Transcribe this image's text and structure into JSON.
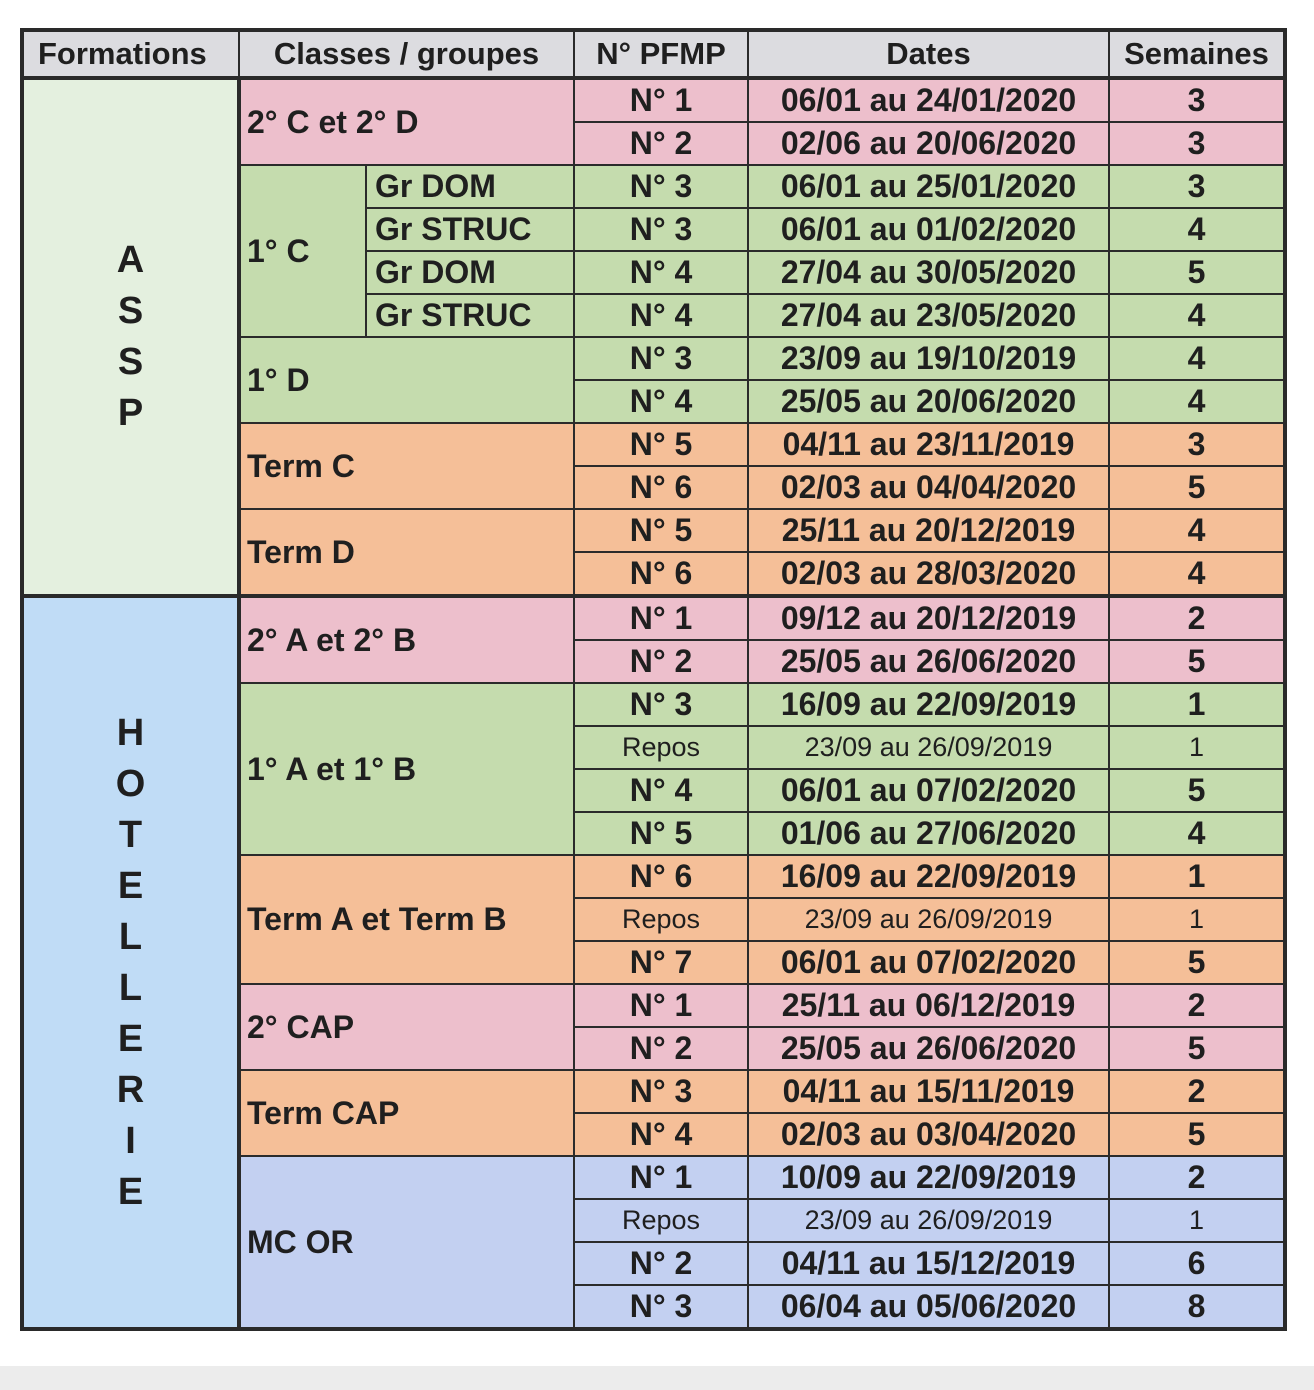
{
  "headers": {
    "formations": "Formations",
    "classes": "Classes / groupes",
    "pfmp": "N° PFMP",
    "dates": "Dates",
    "semaines": "Semaines"
  },
  "colors": {
    "pink": "#edbfcc",
    "green": "#c5dcae",
    "orange": "#f5bf98",
    "lavender": "#c3d0f1",
    "assp_bg": "#e4f0df",
    "hotellerie_bg": "#c0dcf6",
    "header_bg": "#dcdce0"
  },
  "formations": [
    {
      "name": "ASSP",
      "letters": [
        "A",
        "S",
        "S",
        "P"
      ],
      "classes": [
        {
          "label": "2° C et 2° D",
          "color": "pink",
          "rows": [
            {
              "pfmp": "N° 1",
              "dates": "06/01 au 24/01/2020",
              "semaines": "3"
            },
            {
              "pfmp": "N° 2",
              "dates": "02/06 au 20/06/2020",
              "semaines": "3"
            }
          ]
        },
        {
          "label": "1° C",
          "color": "green",
          "groups": [
            {
              "label": "Gr DOM",
              "pfmp": "N° 3",
              "dates": "06/01 au 25/01/2020",
              "semaines": "3"
            },
            {
              "label": "Gr STRUC",
              "pfmp": "N° 3",
              "dates": "06/01 au 01/02/2020",
              "semaines": "4"
            },
            {
              "label": "Gr DOM",
              "pfmp": "N° 4",
              "dates": "27/04 au 30/05/2020",
              "semaines": "5"
            },
            {
              "label": "Gr STRUC",
              "pfmp": "N° 4",
              "dates": "27/04 au 23/05/2020",
              "semaines": "4"
            }
          ]
        },
        {
          "label": "1° D",
          "color": "green",
          "rows": [
            {
              "pfmp": "N° 3",
              "dates": "23/09 au 19/10/2019",
              "semaines": "4"
            },
            {
              "pfmp": "N° 4",
              "dates": "25/05 au 20/06/2020",
              "semaines": "4"
            }
          ]
        },
        {
          "label": "Term C",
          "color": "orange",
          "rows": [
            {
              "pfmp": "N° 5",
              "dates": "04/11 au 23/11/2019",
              "semaines": "3"
            },
            {
              "pfmp": "N° 6",
              "dates": "02/03 au 04/04/2020",
              "semaines": "5"
            }
          ]
        },
        {
          "label": "Term D",
          "color": "orange",
          "rows": [
            {
              "pfmp": "N° 5",
              "dates": "25/11 au 20/12/2019",
              "semaines": "4"
            },
            {
              "pfmp": "N° 6",
              "dates": "02/03 au 28/03/2020",
              "semaines": "4"
            }
          ]
        }
      ]
    },
    {
      "name": "HOTELLERIE",
      "letters": [
        "H",
        "O",
        "T",
        "E",
        "L",
        "L",
        "E",
        "R",
        "I",
        "E"
      ],
      "classes": [
        {
          "label": "2° A et 2° B",
          "color": "pink",
          "rows": [
            {
              "pfmp": "N° 1",
              "dates": "09/12 au 20/12/2019",
              "semaines": "2"
            },
            {
              "pfmp": "N° 2",
              "dates": "25/05 au 26/06/2020",
              "semaines": "5"
            }
          ]
        },
        {
          "label": "1° A et 1° B",
          "color": "green",
          "rows": [
            {
              "pfmp": "N° 3",
              "dates": "16/09 au 22/09/2019",
              "semaines": "1"
            },
            {
              "pfmp": "Repos",
              "dates": "23/09 au 26/09/2019",
              "semaines": "1",
              "repos": true
            },
            {
              "pfmp": "N° 4",
              "dates": "06/01 au 07/02/2020",
              "semaines": "5"
            },
            {
              "pfmp": "N° 5",
              "dates": "01/06 au 27/06/2020",
              "semaines": "4"
            }
          ]
        },
        {
          "label": "Term A et Term B",
          "color": "orange",
          "rows": [
            {
              "pfmp": "N° 6",
              "dates": "16/09 au 22/09/2019",
              "semaines": "1"
            },
            {
              "pfmp": "Repos",
              "dates": "23/09 au 26/09/2019",
              "semaines": "1",
              "repos": true
            },
            {
              "pfmp": "N° 7",
              "dates": "06/01 au 07/02/2020",
              "semaines": "5"
            }
          ]
        },
        {
          "label": "2° CAP",
          "color": "pink",
          "rows": [
            {
              "pfmp": "N° 1",
              "dates": "25/11 au 06/12/2019",
              "semaines": "2"
            },
            {
              "pfmp": "N° 2",
              "dates": "25/05 au 26/06/2020",
              "semaines": "5"
            }
          ]
        },
        {
          "label": "Term CAP",
          "color": "orange",
          "rows": [
            {
              "pfmp": "N° 3",
              "dates": "04/11 au 15/11/2019",
              "semaines": "2"
            },
            {
              "pfmp": "N° 4",
              "dates": "02/03 au 03/04/2020",
              "semaines": "5"
            }
          ]
        },
        {
          "label": "MC OR",
          "color": "lav",
          "rows": [
            {
              "pfmp": "N° 1",
              "dates": "10/09 au 22/09/2019",
              "semaines": "2"
            },
            {
              "pfmp": "Repos",
              "dates": "23/09 au 26/09/2019",
              "semaines": "1",
              "repos": true
            },
            {
              "pfmp": "N° 2",
              "dates": "04/11 au 15/12/2019",
              "semaines": "6"
            },
            {
              "pfmp": "N° 3",
              "dates": "06/04 au 05/06/2020",
              "semaines": "8"
            }
          ]
        }
      ]
    }
  ]
}
